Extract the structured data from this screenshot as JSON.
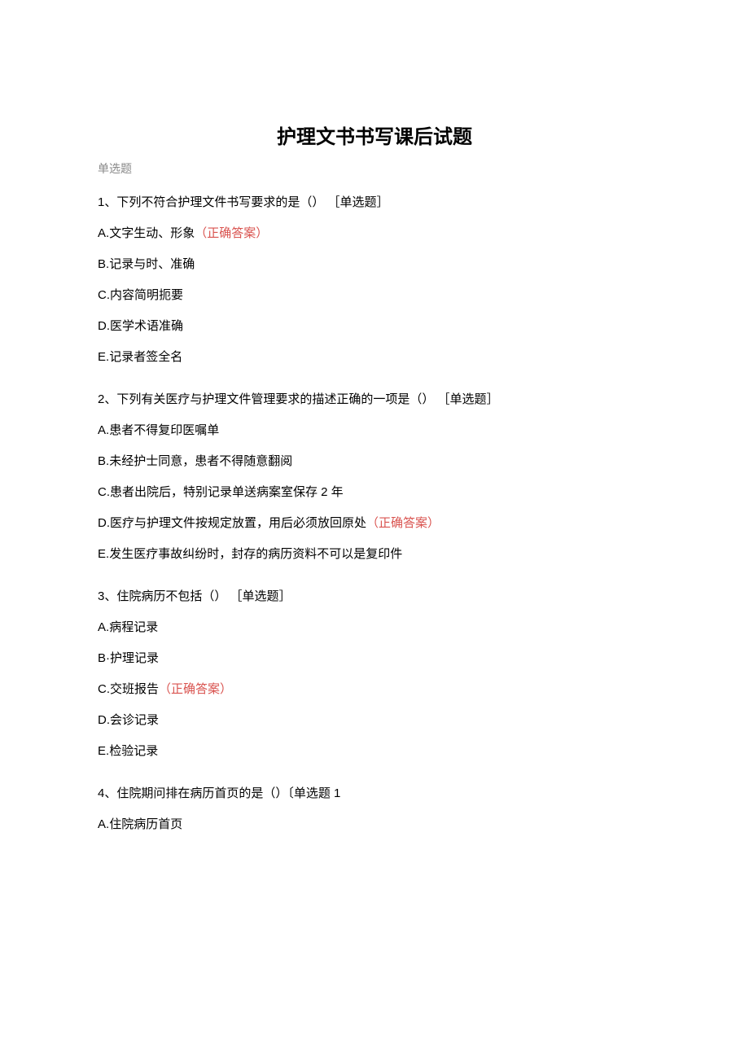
{
  "title": "护理文书书写课后试题",
  "subtitle": "单选题",
  "questions": [
    {
      "stem": "1、下列不符合护理文件书写要求的是（） ［单选题］",
      "options": [
        {
          "prefix": "A.",
          "text": "文字生动、形象",
          "correct": true,
          "marker": "（正确答案）"
        },
        {
          "prefix": "B.",
          "text": "记录与时、准确",
          "correct": false,
          "marker": ""
        },
        {
          "prefix": "C.",
          "text": "内容简明扼要",
          "correct": false,
          "marker": ""
        },
        {
          "prefix": "D.",
          "text": "医学术语准确",
          "correct": false,
          "marker": ""
        },
        {
          "prefix": "E.",
          "text": "记录者签全名",
          "correct": false,
          "marker": ""
        }
      ]
    },
    {
      "stem": "2、下列有关医疗与护理文件管理要求的描述正确的一项是（） ［单选题］",
      "options": [
        {
          "prefix": "A.",
          "text": "患者不得复印医嘱单",
          "correct": false,
          "marker": ""
        },
        {
          "prefix": "B.",
          "text": "未经护士同意，患者不得随意翻阅",
          "correct": false,
          "marker": ""
        },
        {
          "prefix": "C.",
          "text": "患者出院后，特别记录单送病案室保存 2 年",
          "correct": false,
          "marker": ""
        },
        {
          "prefix": "D.",
          "text": "医疗与护理文件按规定放置，用后必须放回原处",
          "correct": true,
          "marker": "（正确答案）"
        },
        {
          "prefix": "E.",
          "text": "发生医疗事故纠纷时，封存的病历资料不可以是复印件",
          "correct": false,
          "marker": ""
        }
      ]
    },
    {
      "stem": "3、住院病历不包括（） ［单选题］",
      "options": [
        {
          "prefix": "A.",
          "text": "病程记录",
          "correct": false,
          "marker": ""
        },
        {
          "prefix": "B·",
          "text": "护理记录",
          "correct": false,
          "marker": ""
        },
        {
          "prefix": "C.",
          "text": "交班报告",
          "correct": true,
          "marker": "（正确答案）"
        },
        {
          "prefix": "D.",
          "text": "会诊记录",
          "correct": false,
          "marker": ""
        },
        {
          "prefix": "E.",
          "text": "检验记录",
          "correct": false,
          "marker": ""
        }
      ]
    },
    {
      "stem": "4、住院期问排在病历首页的是（）〔单选题 1",
      "options": [
        {
          "prefix": "A.",
          "text": "住院病历首页",
          "correct": false,
          "marker": ""
        }
      ]
    }
  ]
}
